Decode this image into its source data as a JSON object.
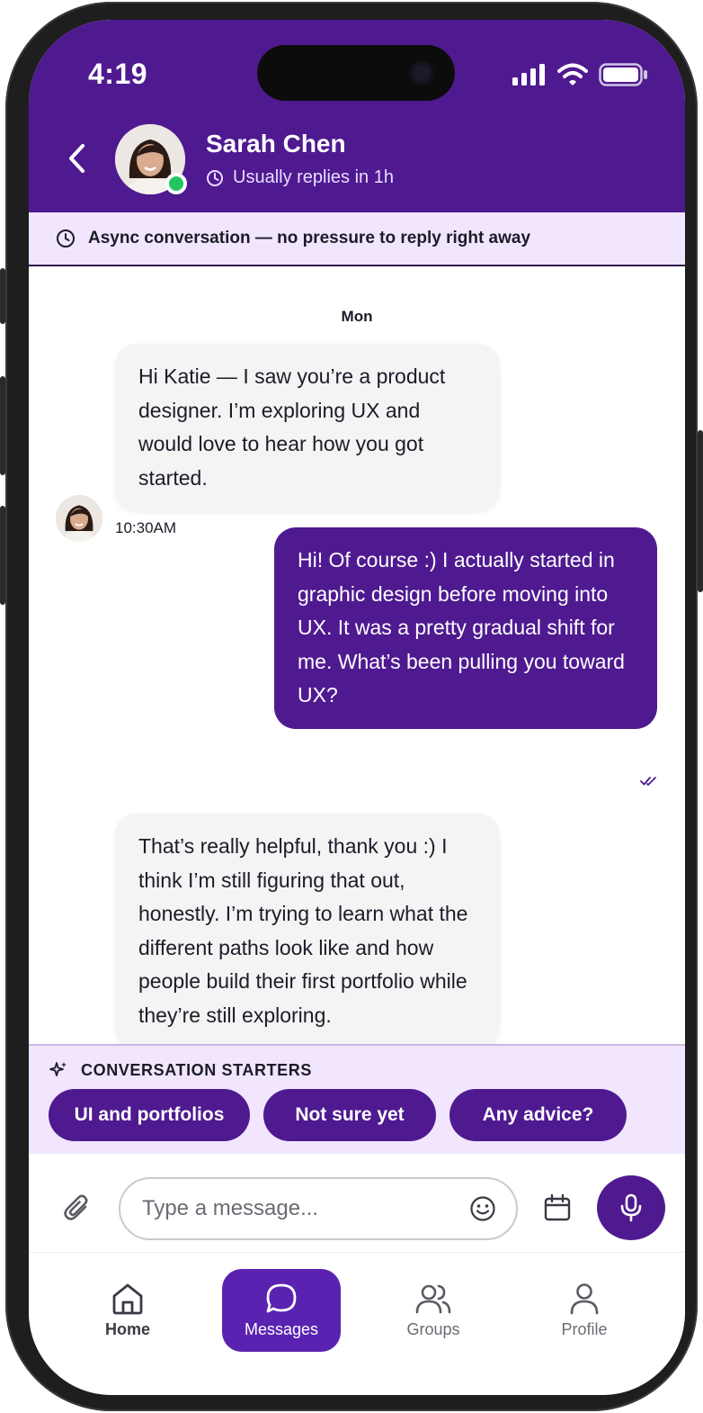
{
  "status_bar": {
    "time": "4:19"
  },
  "header": {
    "contact_name": "Sarah Chen",
    "reply_time": "Usually replies in 1h",
    "online": true
  },
  "banner": {
    "text": "Async conversation — no pressure to reply right away"
  },
  "messages": {
    "day_label": "Mon",
    "items": [
      {
        "direction": "in",
        "text": "Hi Katie — I saw you’re a product designer. I’m exploring UX and would love to hear how you got started.",
        "time": "10:30AM"
      },
      {
        "direction": "out",
        "text": "Hi! Of course :) I actually started in graphic design before moving into UX. It was a pretty gradual shift for me. What’s been pulling you toward UX?",
        "status": "read"
      },
      {
        "direction": "in",
        "text": "That’s really helpful, thank you :) I think I’m still figuring that out, honestly. I’m trying to learn what the different paths look like and how people build their first portfolio while they’re still exploring."
      }
    ]
  },
  "starters": {
    "title": "CONVERSATION STARTERS",
    "chips": [
      "UI and portfolios",
      "Not sure yet",
      "Any advice?"
    ]
  },
  "composer": {
    "placeholder": "Type a message..."
  },
  "tabs": [
    {
      "label": "Home",
      "icon": "home-icon"
    },
    {
      "label": "Messages",
      "icon": "chat-icon",
      "active": true
    },
    {
      "label": "Groups",
      "icon": "groups-icon"
    },
    {
      "label": "Profile",
      "icon": "profile-icon"
    }
  ],
  "colors": {
    "brand": "#4f1a90",
    "banner_bg": "#f1e6fd",
    "online": "#22c55e",
    "active_tab": "#5a22b0"
  }
}
